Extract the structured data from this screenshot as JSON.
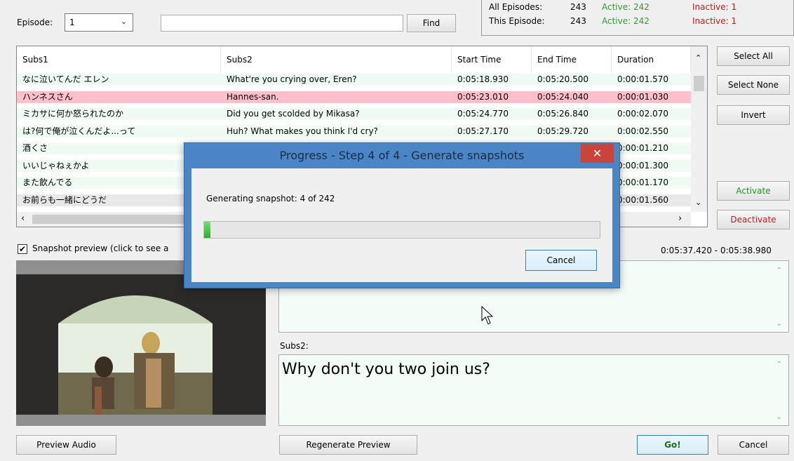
{
  "top": {
    "episode_label": "Episode:",
    "episode_value": "1",
    "find_value": "",
    "find_button": "Find"
  },
  "stats": {
    "all_label": "All Episodes:",
    "all_count": "243",
    "all_active": "Active:  242",
    "all_inactive": "Inactive:  1",
    "this_label": "This Episode:",
    "this_count": "243",
    "this_active": "Active:  242",
    "this_inactive": "Inactive:  1",
    "active_color": "#2e9a2e",
    "inactive_color": "#b22222"
  },
  "grid": {
    "headers": [
      "Subs1",
      "Subs2",
      "Start Time",
      "End Time",
      "Duration"
    ],
    "rows": [
      {
        "subs1": "なに泣いてんだ エレン",
        "subs2": "What're you crying over, Eren?",
        "start": "0:05:18.930",
        "end": "0:05:20.500",
        "dur": "0:00:01.570",
        "state": "active"
      },
      {
        "subs1": "ハンネスさん",
        "subs2": "Hannes-san.",
        "start": "0:05:23.010",
        "end": "0:05:24.040",
        "dur": "0:00:01.030",
        "state": "inactive"
      },
      {
        "subs1": "ミカサに何か怒られたのか",
        "subs2": "Did you get scolded by Mikasa?",
        "start": "0:05:24.770",
        "end": "0:05:26.840",
        "dur": "0:00:02.070",
        "state": "active"
      },
      {
        "subs1": "は?何で俺が泣くんだよ...って",
        "subs2": "Huh? What makes you think I'd cry?",
        "start": "0:05:27.170",
        "end": "0:05:29.720",
        "dur": "0:00:02.550",
        "state": "active"
      },
      {
        "subs1": "酒くさ",
        "subs2": "",
        "start": "",
        "end": "",
        "dur": "0:00:01.210",
        "state": "active"
      },
      {
        "subs1": "いいじゃねぇかよ",
        "subs2": "",
        "start": "",
        "end": "",
        "dur": "0:00:01.300",
        "state": "active"
      },
      {
        "subs1": "また飲んでる",
        "subs2": "",
        "start": "",
        "end": "",
        "dur": "0:00:01.170",
        "state": "active"
      },
      {
        "subs1": "お前らも一緒にどうだ",
        "subs2": "",
        "start": "",
        "end": "",
        "dur": "0:00:01.560",
        "state": "selected"
      }
    ],
    "row_colors": {
      "active": "#f0fbf3",
      "inactive": "#ffc0cb",
      "selected": "#e8e8e8"
    }
  },
  "side_buttons": {
    "select_all": "Select All",
    "select_none": "Select None",
    "invert": "Invert",
    "activate": "Activate",
    "deactivate": "Deactivate",
    "activate_color": "#2e8b2e",
    "deactivate_color": "#b22222"
  },
  "preview": {
    "checkbox_label": "Snapshot preview (click to see a",
    "time_range": "0:05:37.420  -  0:05:38.980",
    "subs2_label": "Subs2:",
    "subs2_text": "Why don't you two join us?"
  },
  "bottom": {
    "preview_audio": "Preview Audio",
    "regenerate": "Regenerate Preview",
    "go": "Go!",
    "cancel": "Cancel"
  },
  "dialog": {
    "title": "Progress - Step 4 of 4 - Generate snapshots",
    "message": "Generating snapshot: 4 of 242",
    "progress": 0.0165,
    "cancel": "Cancel",
    "close_glyph": "✕"
  }
}
